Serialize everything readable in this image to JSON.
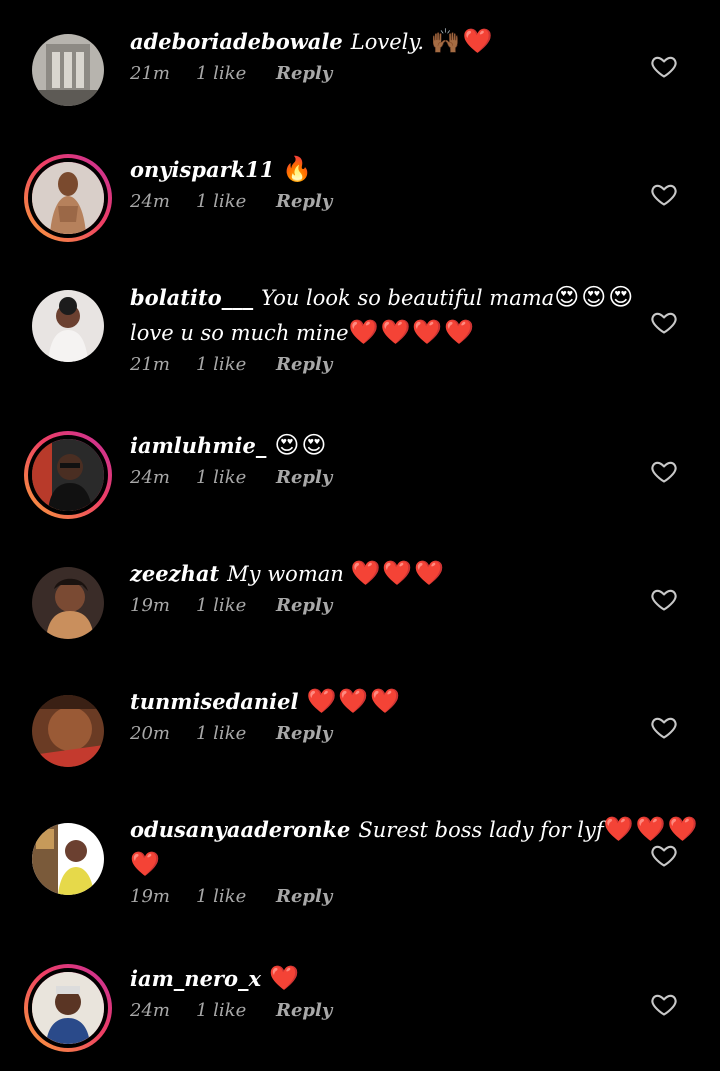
{
  "comments": [
    {
      "username": "adeboriadebowale",
      "text": "Lovely.",
      "emoji": "🙌🏾❤️",
      "text2": "",
      "emoji2": "",
      "time": "21m",
      "likes": "1 like",
      "reply": "Reply",
      "story_ring": false
    },
    {
      "username": "onyispark11",
      "text": "",
      "emoji": "🔥",
      "text2": "",
      "emoji2": "",
      "time": "24m",
      "likes": "1 like",
      "reply": "Reply",
      "story_ring": true
    },
    {
      "username": "bolatito___",
      "text": "You look so beautiful mama",
      "emoji": "😍😍😍",
      "text2": "love u so much mine",
      "emoji2": "❤️❤️❤️❤️",
      "time": "21m",
      "likes": "1 like",
      "reply": "Reply",
      "story_ring": false
    },
    {
      "username": "iamluhmie_",
      "text": "",
      "emoji": "😍😍",
      "text2": "",
      "emoji2": "",
      "time": "24m",
      "likes": "1 like",
      "reply": "Reply",
      "story_ring": true
    },
    {
      "username": "zeezhat",
      "text": "My woman",
      "emoji": "❤️❤️❤️",
      "text2": "",
      "emoji2": "",
      "time": "19m",
      "likes": "1 like",
      "reply": "Reply",
      "story_ring": false
    },
    {
      "username": "tunmisedaniel",
      "text": "",
      "emoji": "❤️❤️❤️",
      "text2": "",
      "emoji2": "",
      "time": "20m",
      "likes": "1 like",
      "reply": "Reply",
      "story_ring": false
    },
    {
      "username": "odusanyaaderonke",
      "text": "Surest boss lady for lyf",
      "emoji": "❤️❤️❤️",
      "text2": "",
      "emoji2": "❤️",
      "time": "19m",
      "likes": "1 like",
      "reply": "Reply",
      "story_ring": false
    },
    {
      "username": "iam_nero_x",
      "text": "",
      "emoji": "❤️",
      "text2": "",
      "emoji2": "",
      "time": "24m",
      "likes": "1 like",
      "reply": "Reply",
      "story_ring": true
    }
  ],
  "colors": {
    "background": "#000000",
    "text": "#ffffff",
    "meta": "#a8a8a8",
    "story_ring_start": "#f9a13a",
    "story_ring_end": "#c52e9d"
  },
  "icons": {
    "like": "heart-outline-icon"
  }
}
